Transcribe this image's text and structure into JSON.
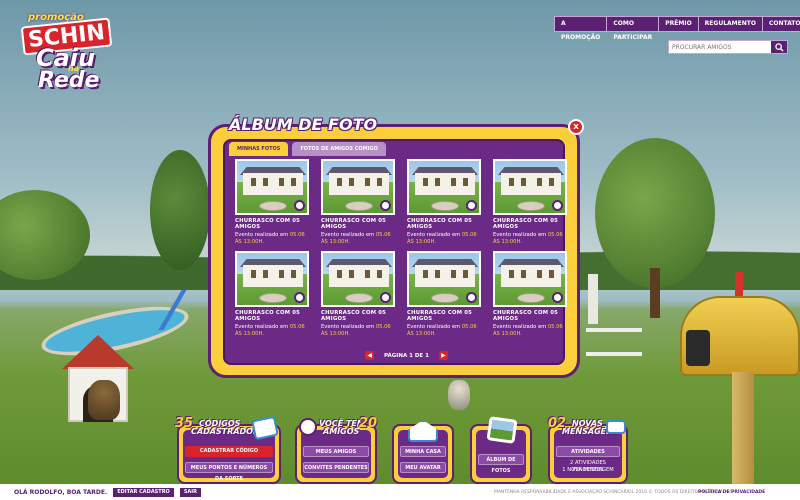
{
  "brand": {
    "promo": "promoção",
    "schin": "SCHIN",
    "caiu": "Caiu",
    "na": "na",
    "rede": "Rede"
  },
  "nav": [
    "A PROMOÇÃO",
    "COMO PARTICIPAR",
    "PRÊMIO",
    "REGULAMENTO",
    "CONTATO"
  ],
  "search": {
    "placeholder": "PROCURAR AMIGOS"
  },
  "album": {
    "title": "ÁLBUM DE FOTO",
    "close": "x",
    "tabs": [
      "MINHAS FOTOS",
      "FOTOS DE AMIGOS COMIGO"
    ],
    "cards": [
      {
        "title": "CHURRASCO COM 05 AMIGOS",
        "line": "Evento realizado em",
        "date": "05.06",
        "time": "ÀS 13:00H."
      },
      {
        "title": "CHURRASCO COM 05 AMIGOS",
        "line": "Evento realizado em",
        "date": "05.06",
        "time": "ÀS 13:00H."
      },
      {
        "title": "CHURRASCO COM 05 AMIGOS",
        "line": "Evento realizado em",
        "date": "05.06",
        "time": "ÀS 13:00H."
      },
      {
        "title": "CHURRASCO COM 05 AMIGOS",
        "line": "Evento realizado em",
        "date": "05.06",
        "time": "ÀS 13:00H."
      },
      {
        "title": "CHURRASCO COM 05 AMIGOS",
        "line": "Evento realizado em",
        "date": "05.06",
        "time": "ÀS 13:00H."
      },
      {
        "title": "CHURRASCO COM 05 AMIGOS",
        "line": "Evento realizado em",
        "date": "05.06",
        "time": "ÀS 13:00H."
      },
      {
        "title": "CHURRASCO COM 05 AMIGOS",
        "line": "Evento realizado em",
        "date": "05.06",
        "time": "ÀS 13:00H."
      },
      {
        "title": "CHURRASCO COM 05 AMIGOS",
        "line": "Evento realizado em",
        "date": "05.06",
        "time": "ÀS 13:00H."
      }
    ],
    "pager": {
      "prev": "◀",
      "label": "PÁGINA 1 DE 1",
      "next": "▶"
    }
  },
  "widgets": {
    "codes": {
      "count": "35",
      "head1": "CÓDIGOS",
      "head2": "CADASTRADOS",
      "btn1": "CADASTRAR CÓDIGO",
      "btn2": "MEUS PONTOS E NÚMEROS DA SORTE"
    },
    "friends": {
      "head1": "VOCÊ TEM",
      "head2": "AMIGOS",
      "count": "20",
      "btn1": "MEUS AMIGOS",
      "btn2": "CONVITES PENDENTES"
    },
    "house": {
      "btn1": "MINHA CASA",
      "btn2": "MEU AVATAR"
    },
    "photos": {
      "btn1": "ÁLBUM DE FOTOS"
    },
    "messages": {
      "count": "02",
      "head1": "NOVAS",
      "head2": "MENSAGENS",
      "btn1": "ATIVIDADES",
      "msg1": "2 ATIVIDADES PENDENTES",
      "msg2": "1 NOVA MENSAGEM"
    }
  },
  "footer": {
    "greeting": "OLÁ RODOLFO, BOA TARDE.",
    "edit": "EDITAR CADASTRO",
    "logout": "SAIR",
    "legal": "MANTENHA RESPONSABILIDADE E ASSOCIAÇÃO SCHINCARIOL 2010 © TODOS OS DIREITOS RESERVADOS",
    "policy": "POLÍTICA DE PRIVACIDADE"
  },
  "colors": {
    "purple": "#5b1f73",
    "yellow": "#fbcf3c",
    "red": "#d8242a"
  }
}
